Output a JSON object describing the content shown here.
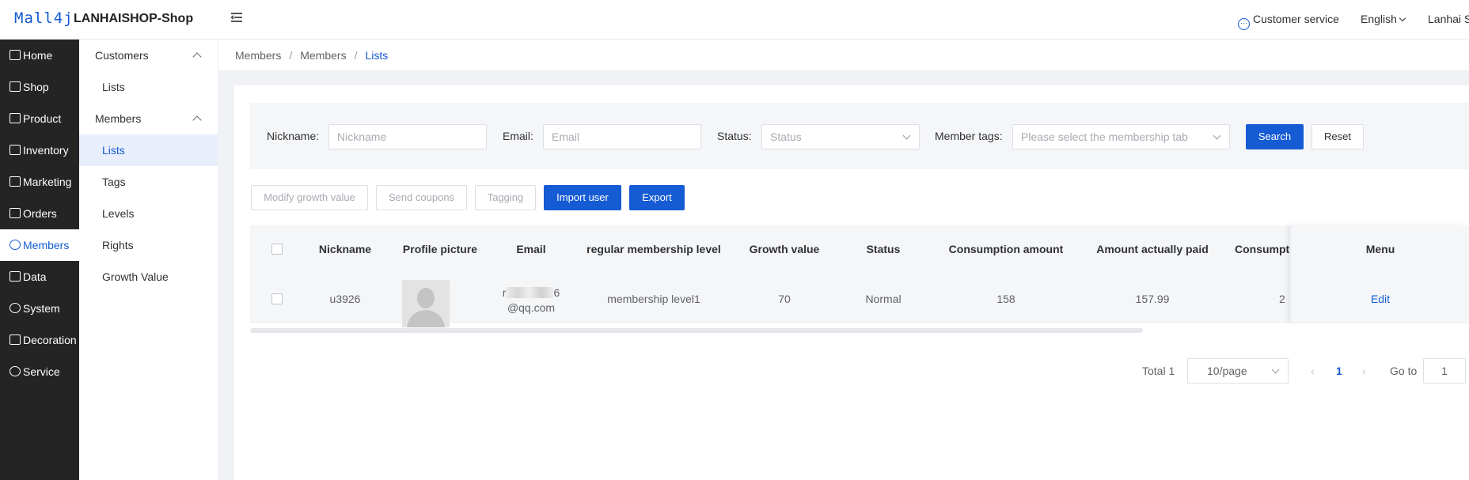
{
  "header": {
    "logo": "Mall4j",
    "shop_name": "LANHAISHOP-Shop",
    "customer_service": "Customer service",
    "language": "English",
    "user": "Lanhai S"
  },
  "sidebar": {
    "items": [
      {
        "label": "Home",
        "icon": "home-icon"
      },
      {
        "label": "Shop",
        "icon": "shop-icon"
      },
      {
        "label": "Product",
        "icon": "product-icon"
      },
      {
        "label": "Inventory",
        "icon": "inventory-icon"
      },
      {
        "label": "Marketing",
        "icon": "marketing-icon"
      },
      {
        "label": "Orders",
        "icon": "orders-icon"
      },
      {
        "label": "Members",
        "icon": "members-icon"
      },
      {
        "label": "Data",
        "icon": "data-icon"
      },
      {
        "label": "System",
        "icon": "system-icon"
      },
      {
        "label": "Decoration",
        "icon": "decoration-icon"
      },
      {
        "label": "Service",
        "icon": "service-icon"
      }
    ],
    "active": "Members"
  },
  "subnav": {
    "groups": [
      {
        "label": "Customers",
        "items": [
          "Lists"
        ]
      },
      {
        "label": "Members",
        "items": [
          "Lists",
          "Tags",
          "Levels",
          "Rights",
          "Growth Value"
        ]
      }
    ],
    "active": "Members/Lists"
  },
  "breadcrumb": [
    "Members",
    "Members",
    "Lists"
  ],
  "filters": {
    "nickname_label": "Nickname:",
    "nickname_placeholder": "Nickname",
    "email_label": "Email:",
    "email_placeholder": "Email",
    "status_label": "Status:",
    "status_placeholder": "Status",
    "tags_label": "Member tags:",
    "tags_placeholder": "Please select the membership tab",
    "search_button": "Search",
    "reset_button": "Reset"
  },
  "actions": {
    "modify_growth": "Modify growth value",
    "send_coupons": "Send coupons",
    "tagging": "Tagging",
    "import_user": "Import user",
    "export": "Export"
  },
  "table": {
    "columns": [
      "Nickname",
      "Profile picture",
      "Email",
      "regular membership level",
      "Growth value",
      "Status",
      "Consumption amount",
      "Amount actually paid",
      "Consumpt",
      "Menu"
    ],
    "rows": [
      {
        "nickname": "u3926",
        "email_line1_start": "r",
        "email_line1_end": "6",
        "email_line2": "@qq.com",
        "level": "membership level1",
        "growth": "70",
        "status": "Normal",
        "consumption": "158",
        "paid": "157.99",
        "consumpt_partial": "2",
        "menu": "Edit"
      }
    ]
  },
  "pagination": {
    "total": "Total 1",
    "page_size": "10/page",
    "current_page": "1",
    "goto_label": "Go to",
    "goto_value": "1"
  },
  "colors": {
    "accent": "#155bd4",
    "sidebar_bg": "#242424",
    "active_sub_bg": "#e8eefb"
  }
}
